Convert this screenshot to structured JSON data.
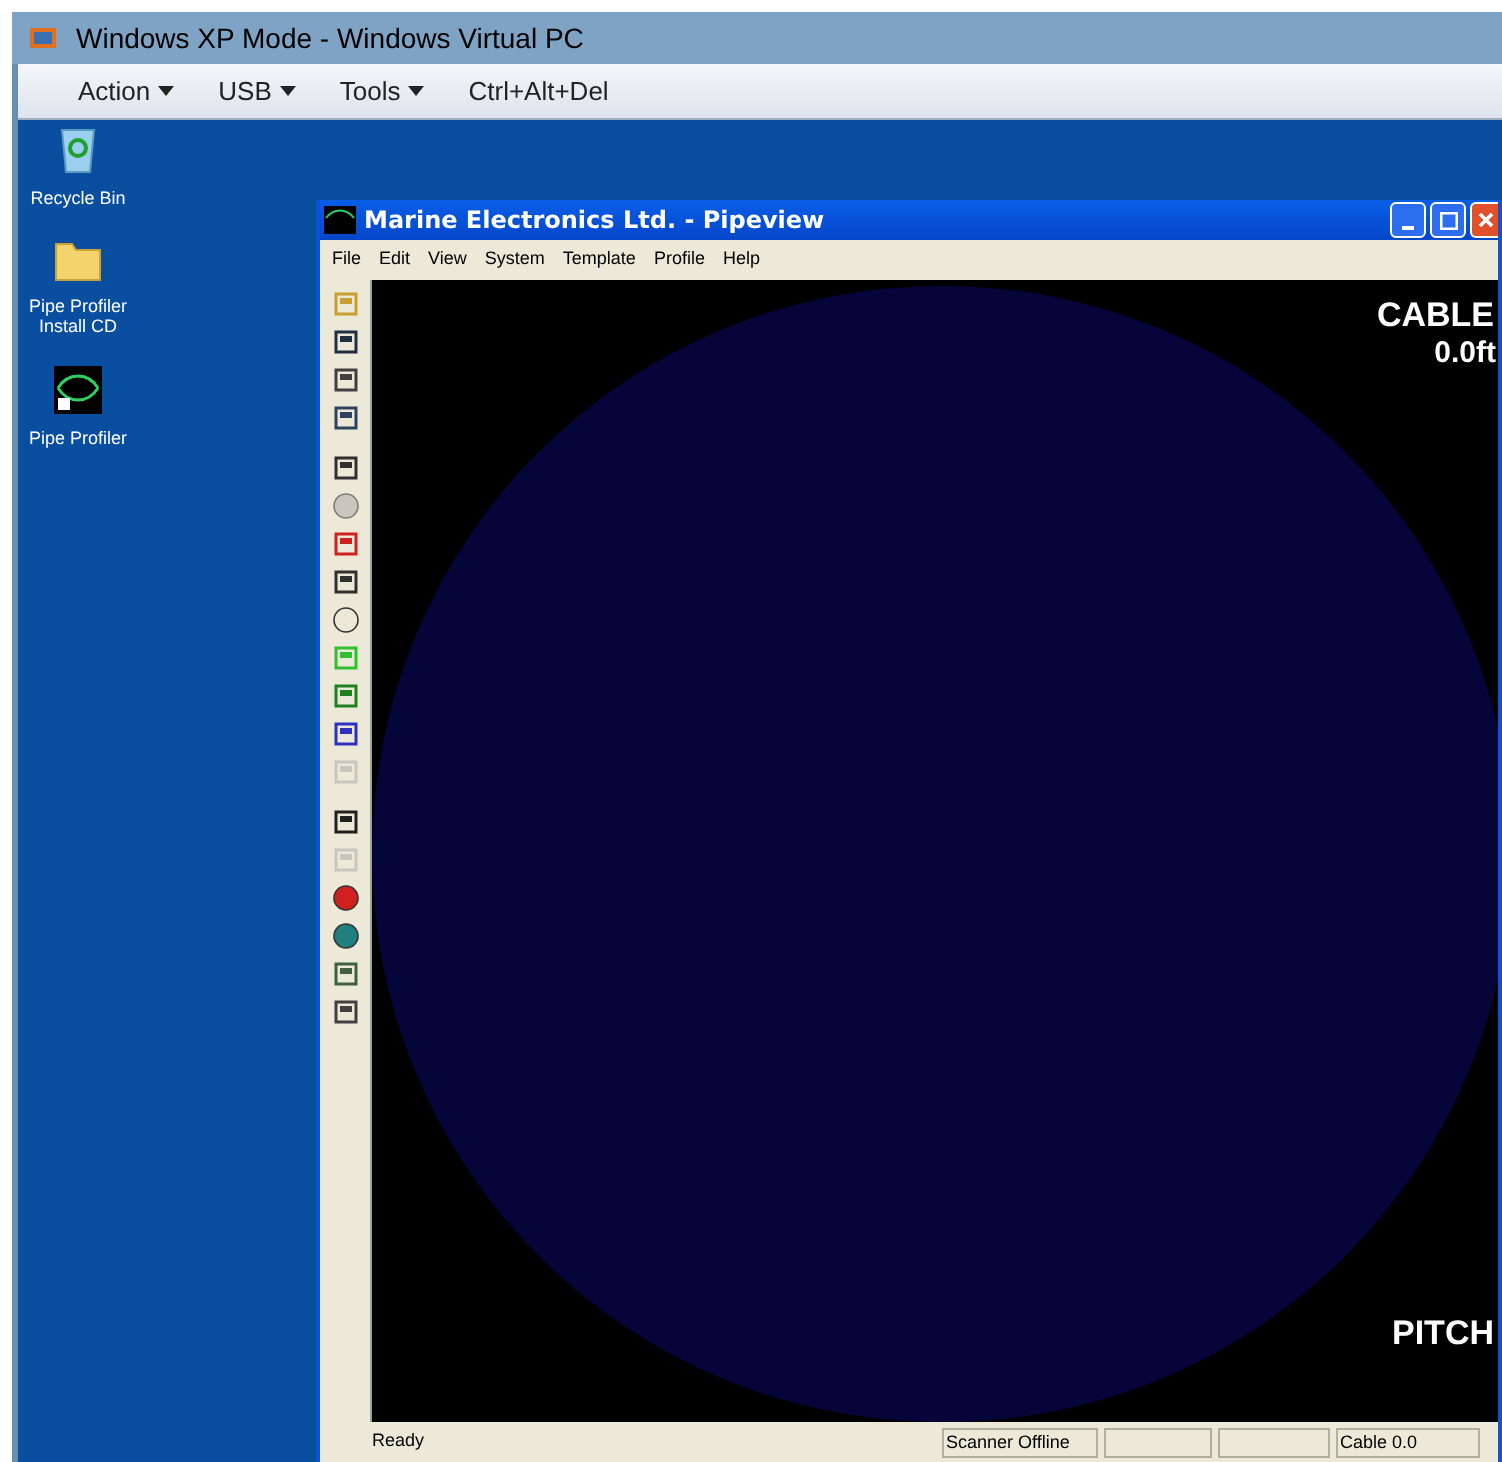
{
  "host": {
    "title": "Windows XP Mode - Windows Virtual PC",
    "menu": [
      {
        "label": "Action",
        "dropdown": true
      },
      {
        "label": "USB",
        "dropdown": true
      },
      {
        "label": "Tools",
        "dropdown": true
      },
      {
        "label": "Ctrl+Alt+Del",
        "dropdown": false
      }
    ]
  },
  "desktop_icons": [
    {
      "label": "Recycle Bin",
      "kind": "recycle"
    },
    {
      "label": "Pipe Profiler Install CD",
      "kind": "folder"
    },
    {
      "label": "Pipe Profiler",
      "kind": "app"
    }
  ],
  "window": {
    "title": "Marine Electronics Ltd. - Pipeview",
    "menu": [
      "File",
      "Edit",
      "View",
      "System",
      "Template",
      "Profile",
      "Help"
    ]
  },
  "toolbar": [
    {
      "disabled": false
    },
    {
      "disabled": false
    },
    {
      "disabled": false
    },
    {
      "disabled": false
    },
    {
      "disabled": false
    },
    {
      "disabled": true
    },
    {
      "disabled": false
    },
    {
      "disabled": false
    },
    {
      "disabled": false
    },
    {
      "disabled": false
    },
    {
      "disabled": false
    },
    {
      "disabled": false
    },
    {
      "disabled": true
    },
    {
      "disabled": false
    },
    {
      "disabled": true
    },
    {
      "disabled": false
    },
    {
      "disabled": false
    },
    {
      "disabled": false
    },
    {
      "disabled": false
    }
  ],
  "display": {
    "cable_label": "CABLE",
    "cable_value": "0.0ft",
    "pitch_label": "PITCH"
  },
  "status_bar": {
    "message": "Ready",
    "scanner": "Scanner Offline",
    "cable": "Cable 0.0"
  }
}
